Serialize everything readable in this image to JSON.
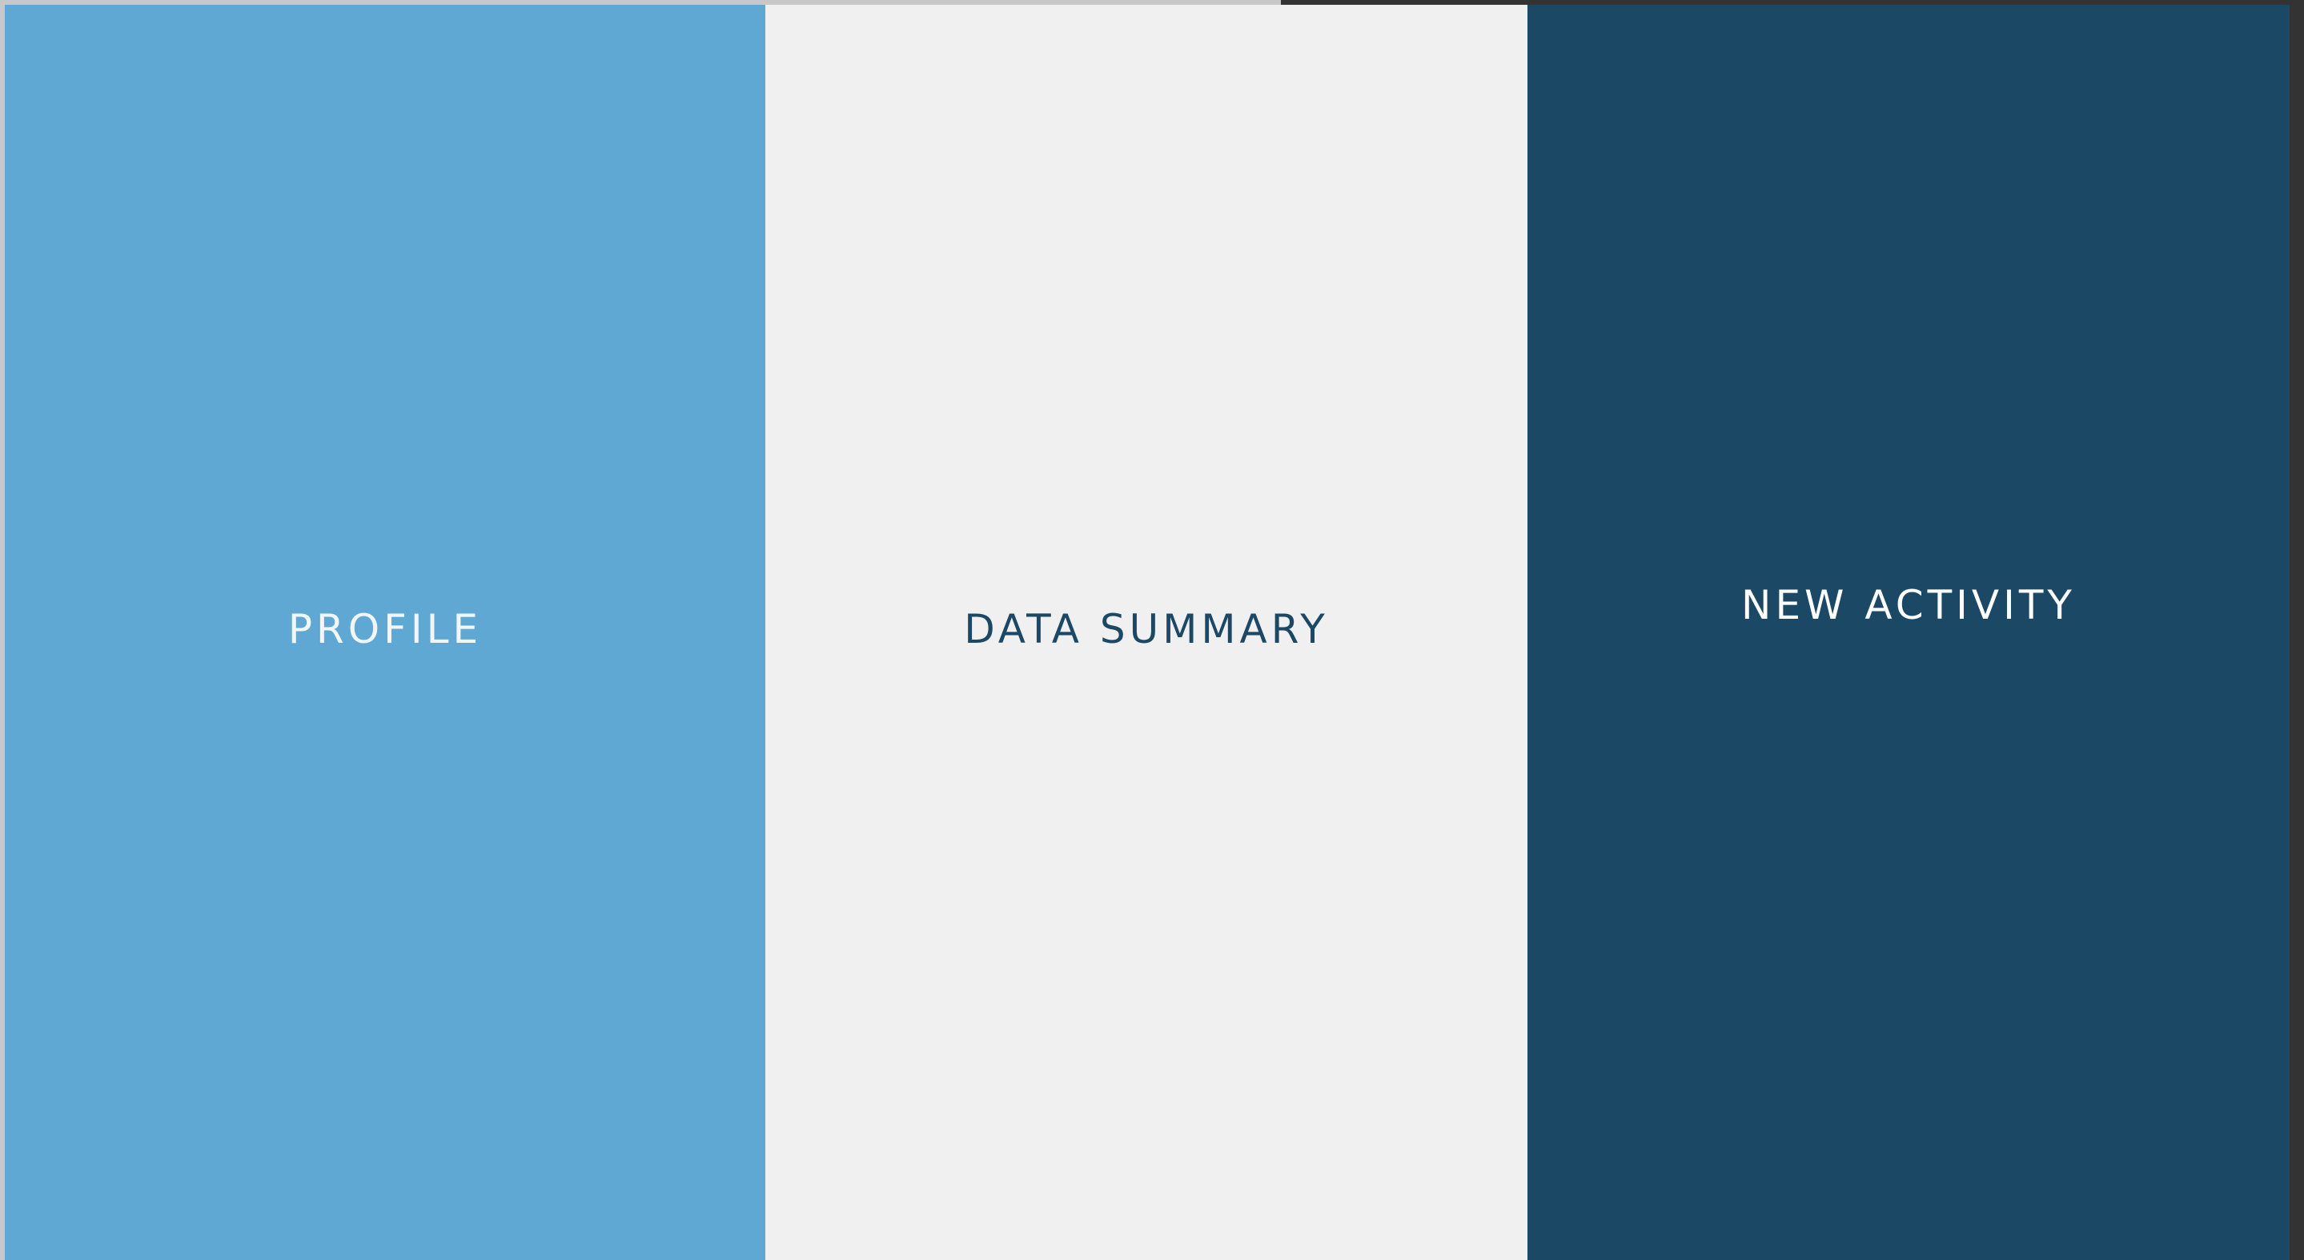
{
  "panels": {
    "profile": {
      "label": "PROFILE",
      "background": "#5fa8d3",
      "text_color": "#f2f6f9"
    },
    "data_summary": {
      "label": "DATA SUMMARY",
      "background": "#f0f0f0",
      "text_color": "#1b4965"
    },
    "new_activity": {
      "label": "NEW ACTIVITY",
      "background": "#1b4965",
      "text_color": "#ffffff"
    }
  }
}
